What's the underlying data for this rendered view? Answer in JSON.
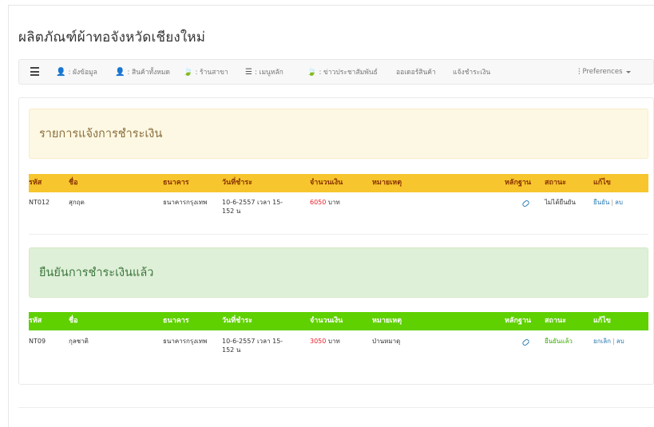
{
  "page_title": "ผลิตภัณฑ์ผ้าทอจังหวัดเชียงใหม่",
  "navbar": {
    "items": [
      {
        "icon": "user-icon",
        "glyph": "👤",
        "label": ": ผังข้อมูล"
      },
      {
        "icon": "user-icon",
        "glyph": "👤",
        "label": ": สินค้าทั้งหมด"
      },
      {
        "icon": "leaf-icon",
        "glyph": "🍃",
        "label": ": ร้านสาขา"
      },
      {
        "icon": "list-icon",
        "glyph": "☰",
        "label": ": เมนูหลัก"
      },
      {
        "icon": "leaf-icon",
        "glyph": "🍃",
        "label": ": ข่าวประชาสัมพันธ์"
      },
      {
        "icon": "",
        "glyph": "",
        "label": "ออเดอร์สินค้า"
      },
      {
        "icon": "",
        "glyph": "",
        "label": "แจ้งชำระเงิน"
      }
    ],
    "preferences": {
      "icon": "bar-chart-icon",
      "glyph": "⫶",
      "label": "Preferences"
    }
  },
  "pending_section": {
    "heading": "รายการแจ้งการชำระเงิน",
    "columns": [
      "รหัส",
      "ชื่อ",
      "ธนาคาร",
      "วันที่ชำระ",
      "จำนวนเงิน",
      "หมายเหตุ",
      "หลักฐาน",
      "สถานะ",
      "แก้ไข"
    ],
    "rows": [
      {
        "id": "NT012",
        "name": "สุกฤต",
        "bank": "ธนาคารกรุงเทพ",
        "date_line1": "10-6-2557 เวลา 15-",
        "date_line2": "152 น",
        "amount": "6050",
        "currency": "บาท",
        "note": "",
        "status": "ไม่ได้ยืนยัน",
        "action1": "ยืนยัน",
        "action2": "ลบ"
      }
    ]
  },
  "confirmed_section": {
    "heading": "ยืนยันการชำระเงินแล้ว",
    "columns": [
      "รหัส",
      "ชื่อ",
      "ธนาคาร",
      "วันที่ชำระ",
      "จำนวนเงิน",
      "หมายเหตุ",
      "หลักฐาน",
      "สถานะ",
      "แก้ไข"
    ],
    "rows": [
      {
        "id": "NT09",
        "name": "กุลชาติ",
        "bank": "ธนาคารกรุงเทพ",
        "date_line1": "10-6-2557 เวลา 15-",
        "date_line2": "152 น",
        "amount": "3050",
        "currency": "บาท",
        "note": "ป่านหมาดุ",
        "status": "ยืนยันแล้ว",
        "action1": "ยกเลิก",
        "action2": "ลบ"
      }
    ]
  },
  "colors": {
    "pending_header": "#f7c62e",
    "confirmed_header": "#5fd000",
    "amount": "#e8212b",
    "link": "#2a7ab0"
  }
}
